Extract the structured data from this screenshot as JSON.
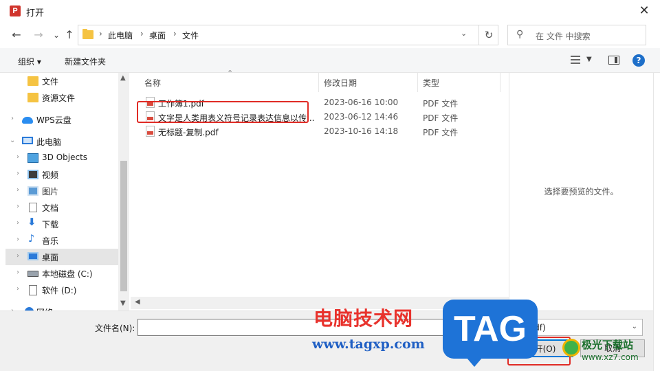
{
  "window": {
    "title": "打开",
    "app_icon_letter": "P"
  },
  "nav": {
    "back_icon": "←",
    "forward_icon": "→",
    "recent_icon": "⌄",
    "up_icon": "↑",
    "breadcrumb": [
      "此电脑",
      "桌面",
      "文件"
    ],
    "search_placeholder": "在 文件 中搜索"
  },
  "toolbar": {
    "organize_label": "组织 ▾",
    "new_folder_label": "新建文件夹",
    "help_label": "?"
  },
  "sidebar": {
    "items": [
      {
        "label": "文件",
        "icon": "folder-icon"
      },
      {
        "label": "资源文件",
        "icon": "folder-icon"
      },
      {
        "label": "WPS云盘",
        "icon": "cloud-icon"
      },
      {
        "label": "此电脑",
        "icon": "computer-icon"
      },
      {
        "label": "3D Objects",
        "icon": "3d-objects-icon"
      },
      {
        "label": "视频",
        "icon": "video-icon"
      },
      {
        "label": "图片",
        "icon": "picture-icon"
      },
      {
        "label": "文档",
        "icon": "document-icon"
      },
      {
        "label": "下载",
        "icon": "download-icon"
      },
      {
        "label": "音乐",
        "icon": "music-icon"
      },
      {
        "label": "桌面",
        "icon": "desktop-icon",
        "selected": true
      },
      {
        "label": "本地磁盘 (C:)",
        "icon": "disk-icon"
      },
      {
        "label": "软件 (D:)",
        "icon": "drive-icon"
      },
      {
        "label": "网络",
        "icon": "network-icon"
      }
    ]
  },
  "filelist": {
    "columns": [
      "名称",
      "修改日期",
      "类型"
    ],
    "rows": [
      {
        "name": "工作簿1.pdf",
        "date": "2023-06-16 10:00",
        "type": "PDF 文件"
      },
      {
        "name": "文字是人类用表义符号记录表达信息以传...",
        "date": "2023-06-12 14:46",
        "type": "PDF 文件"
      },
      {
        "name": "无标题-复制.pdf",
        "date": "2023-10-16 14:18",
        "type": "PDF 文件"
      }
    ]
  },
  "preview": {
    "text": "选择要预览的文件。"
  },
  "footer": {
    "filename_label": "文件名(N):",
    "filename_value": "",
    "filetype_value": "(*.pdf)",
    "open_label": "打开(O)",
    "cancel_label": "取消"
  },
  "watermarks": {
    "site_title": "电脑技术网",
    "site_url": "www.tagxp.com",
    "tag": "TAG",
    "right_title": "极光下载站",
    "right_url": "www.xz7.com"
  },
  "colors": {
    "highlight_box": "#e02b25",
    "accent": "#0078d7",
    "selected_bg": "#e5e5e5"
  }
}
